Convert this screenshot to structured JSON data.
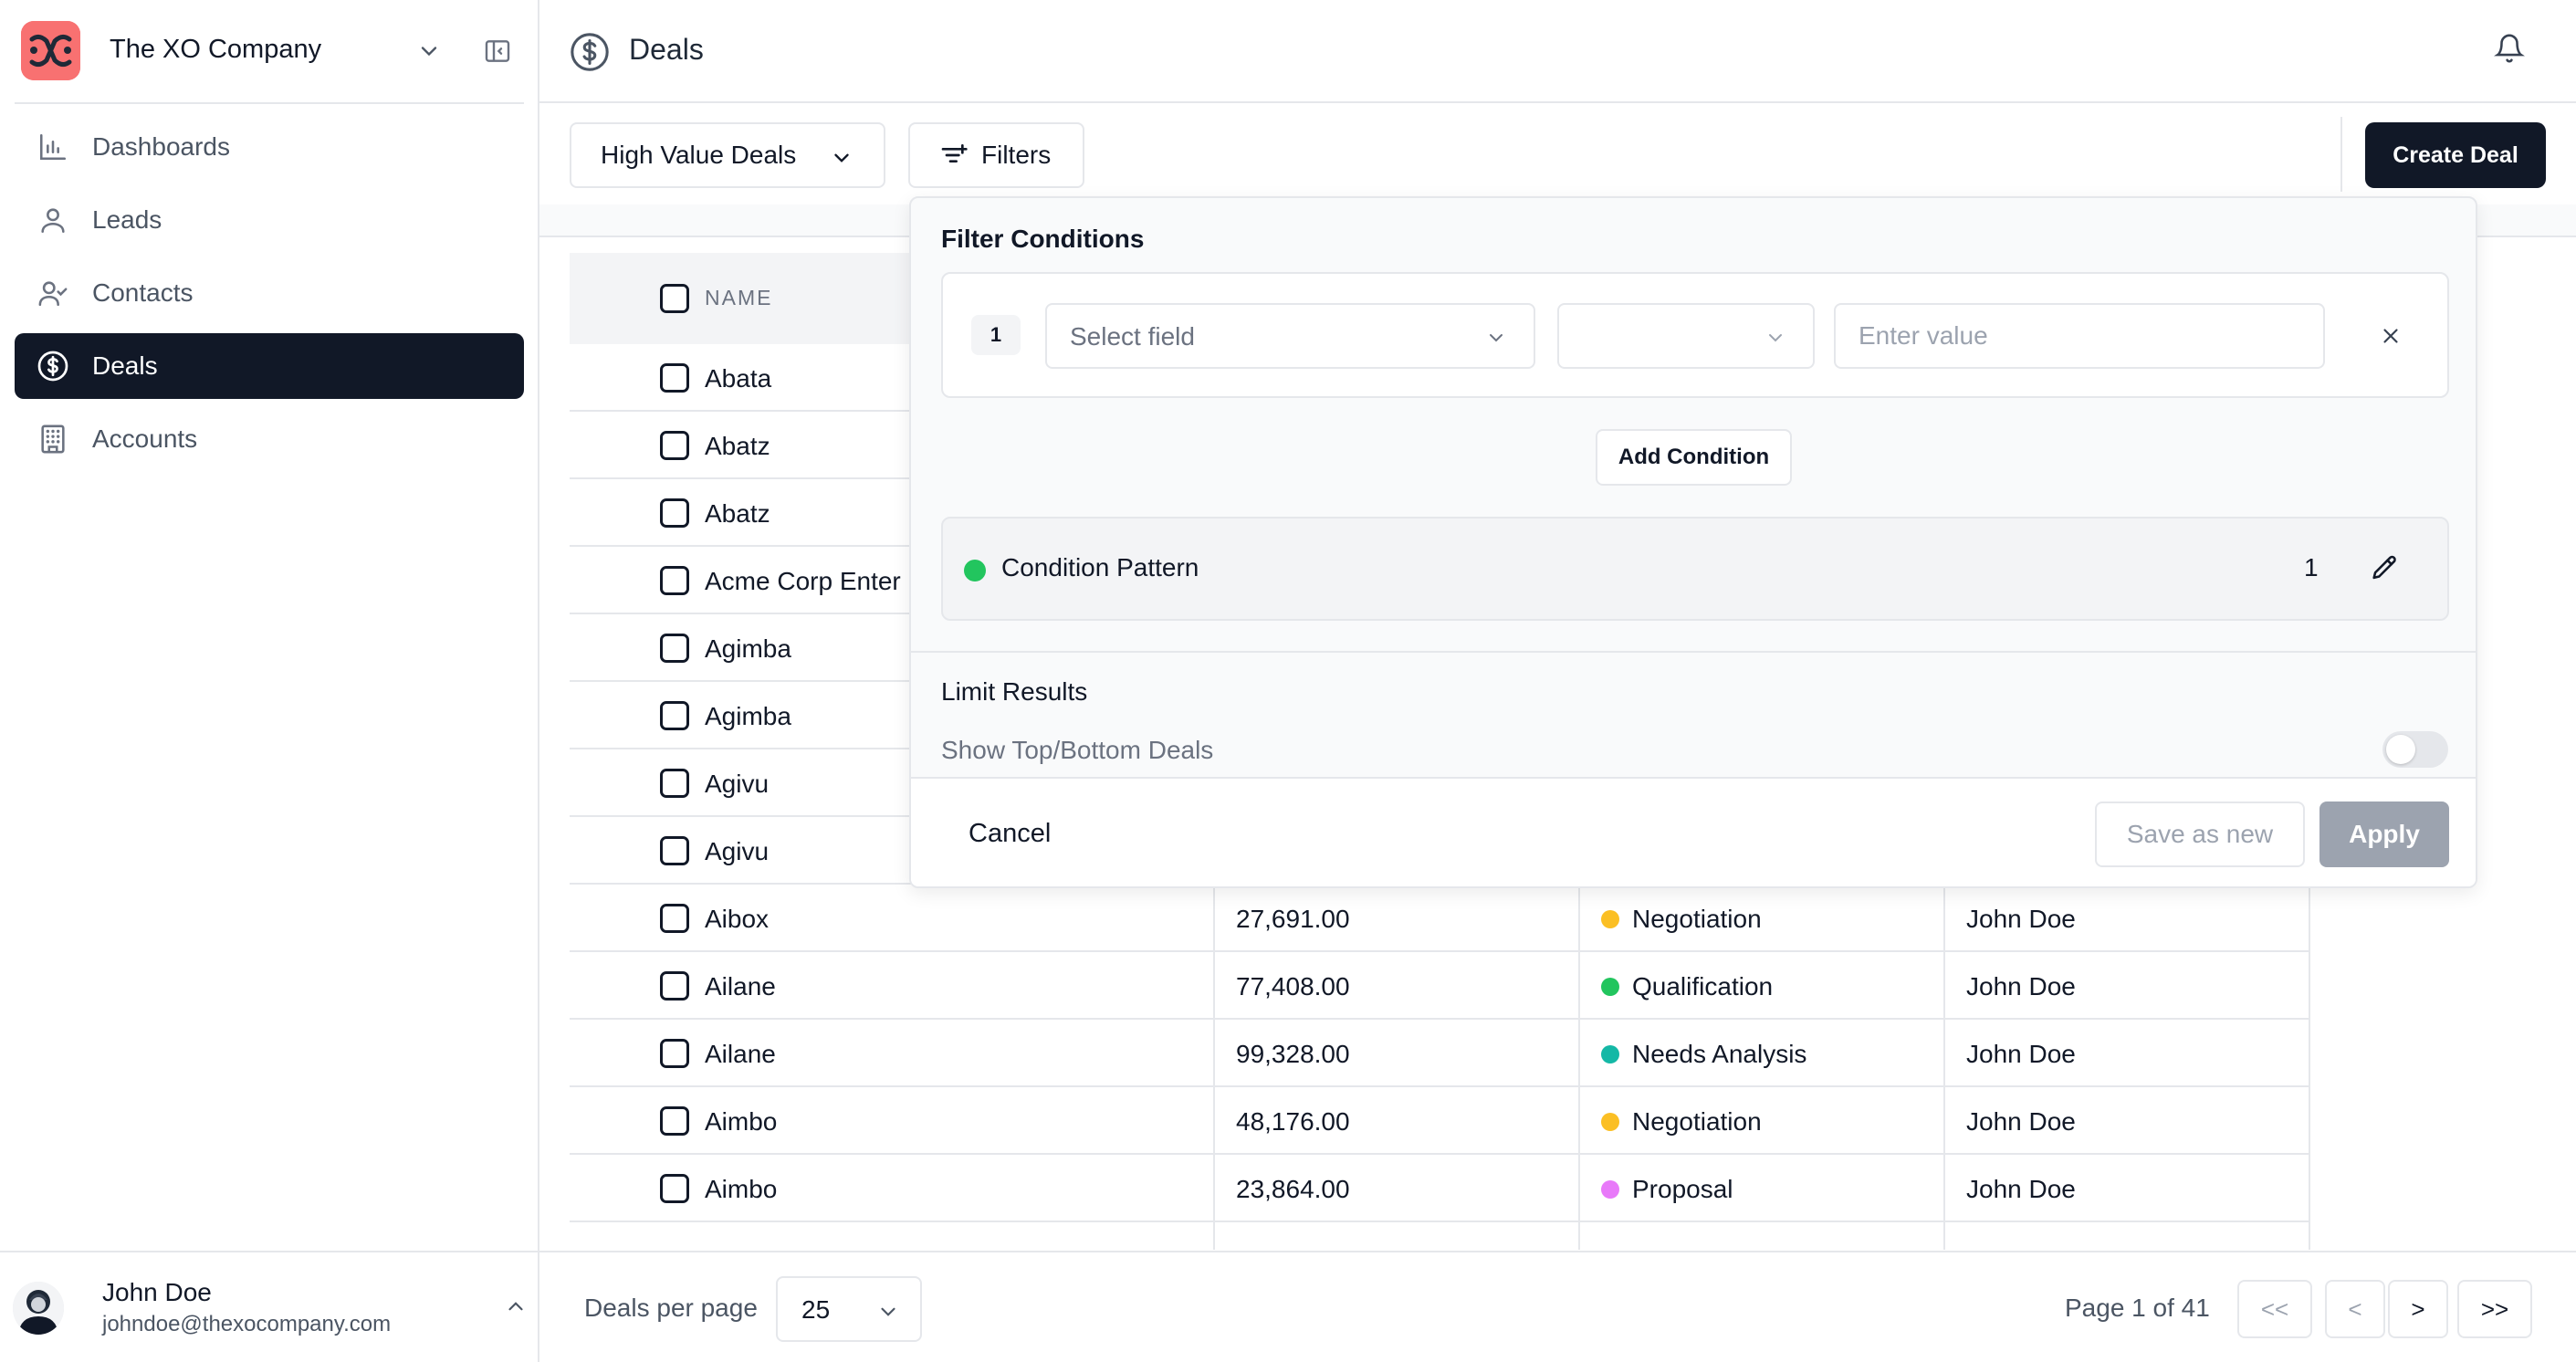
{
  "company": {
    "name": "The XO Company"
  },
  "nav": {
    "items": [
      {
        "label": "Dashboards",
        "icon": "bar-chart-icon",
        "active": false
      },
      {
        "label": "Leads",
        "icon": "user-icon",
        "active": false
      },
      {
        "label": "Contacts",
        "icon": "user-check-icon",
        "active": false
      },
      {
        "label": "Deals",
        "icon": "dollar-circle-icon",
        "active": true
      },
      {
        "label": "Accounts",
        "icon": "building-icon",
        "active": false
      }
    ]
  },
  "user": {
    "name": "John Doe",
    "email": "johndoe@thexocompany.com"
  },
  "header": {
    "title": "Deals"
  },
  "toolbar": {
    "view": "High Value Deals",
    "filters_label": "Filters",
    "create_label": "Create Deal"
  },
  "table": {
    "name_header": "NAME",
    "rows": [
      {
        "name": "Abata",
        "amount": "",
        "stage": "",
        "stage_color": "",
        "owner": ""
      },
      {
        "name": "Abatz",
        "amount": "",
        "stage": "",
        "stage_color": "",
        "owner": ""
      },
      {
        "name": "Abatz",
        "amount": "",
        "stage": "",
        "stage_color": "",
        "owner": ""
      },
      {
        "name": "Acme Corp Enter",
        "amount": "",
        "stage": "",
        "stage_color": "",
        "owner": ""
      },
      {
        "name": "Agimba",
        "amount": "",
        "stage": "",
        "stage_color": "",
        "owner": ""
      },
      {
        "name": "Agimba",
        "amount": "",
        "stage": "",
        "stage_color": "",
        "owner": ""
      },
      {
        "name": "Agivu",
        "amount": "",
        "stage": "",
        "stage_color": "",
        "owner": ""
      },
      {
        "name": "Agivu",
        "amount": "",
        "stage": "",
        "stage_color": "",
        "owner": ""
      },
      {
        "name": "Aibox",
        "amount": "27,691.00",
        "stage": "Negotiation",
        "stage_color": "#fbbf24",
        "owner": "John Doe"
      },
      {
        "name": "Ailane",
        "amount": "77,408.00",
        "stage": "Qualification",
        "stage_color": "#22c55e",
        "owner": "John Doe"
      },
      {
        "name": "Ailane",
        "amount": "99,328.00",
        "stage": "Needs Analysis",
        "stage_color": "#14b8a6",
        "owner": "John Doe"
      },
      {
        "name": "Aimbo",
        "amount": "48,176.00",
        "stage": "Negotiation",
        "stage_color": "#fbbf24",
        "owner": "John Doe"
      },
      {
        "name": "Aimbo",
        "amount": "23,864.00",
        "stage": "Proposal",
        "stage_color": "#e879f9",
        "owner": "John Doe"
      }
    ]
  },
  "footer": {
    "per_page_label": "Deals per page",
    "per_page_value": "25",
    "page_info": "Page 1 of 41",
    "first": "<<",
    "prev": "<",
    "next": ">",
    "last": ">>"
  },
  "filter_panel": {
    "title": "Filter Conditions",
    "condition_number": "1",
    "field_placeholder": "Select field",
    "value_placeholder": "Enter value",
    "add_condition": "Add Condition",
    "pattern_label": "Condition Pattern",
    "pattern_value": "1",
    "limit_title": "Limit Results",
    "limit_label": "Show Top/Bottom Deals",
    "cancel": "Cancel",
    "save_as_new": "Save as new",
    "apply": "Apply"
  }
}
